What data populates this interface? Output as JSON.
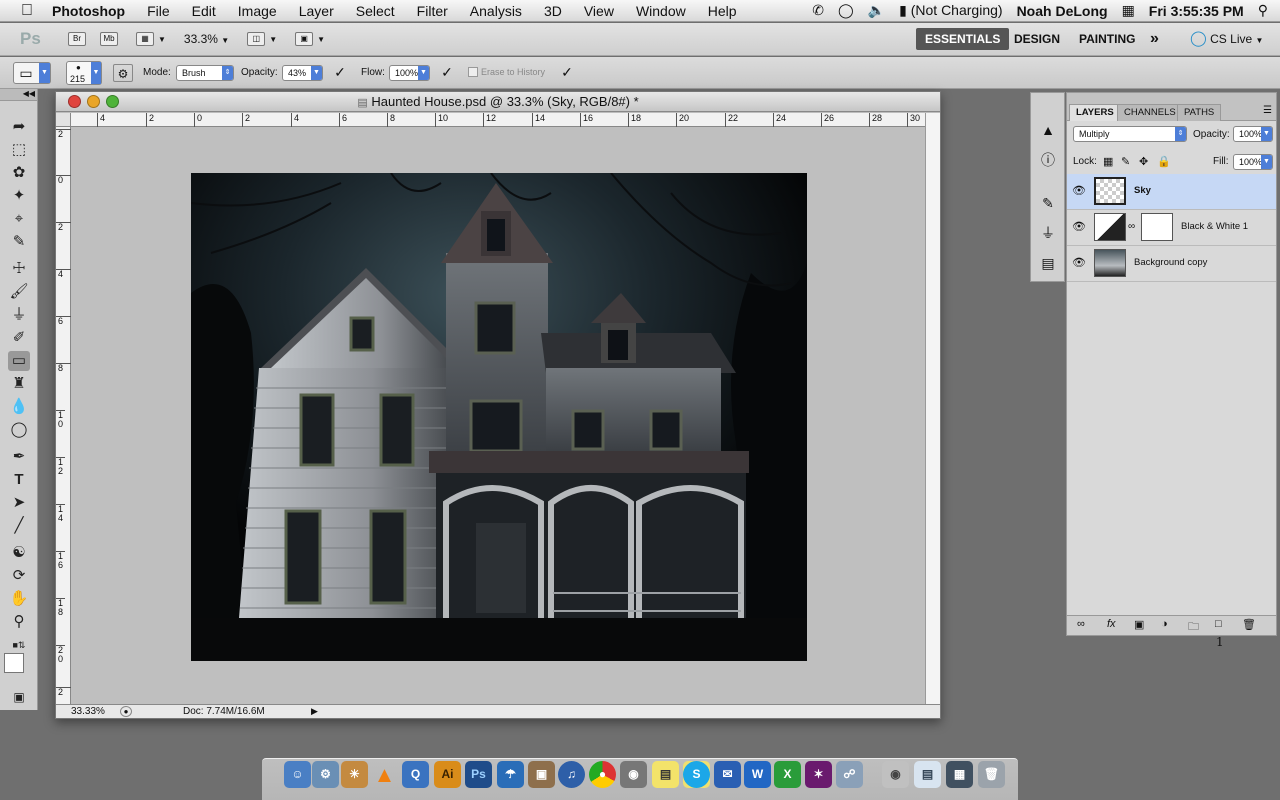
{
  "menubar": {
    "app_name": "Photoshop",
    "menus": [
      "File",
      "Edit",
      "Image",
      "Layer",
      "Select",
      "Filter",
      "Analysis",
      "3D",
      "View",
      "Window",
      "Help"
    ],
    "battery_status": "(Not Charging)",
    "user": "Noah DeLong",
    "clock": "Fri 3:55:35 PM"
  },
  "appbar": {
    "logo": "Ps",
    "bridge": "Br",
    "minibridge": "Mb",
    "zoom": "33.3%",
    "workspaces": [
      "ESSENTIALS",
      "DESIGN",
      "PAINTING"
    ],
    "active_workspace": "ESSENTIALS",
    "more": "»",
    "cs_live": "CS Live"
  },
  "options": {
    "brush_size": "215",
    "mode_label": "Mode:",
    "mode_value": "Brush",
    "opacity_label": "Opacity:",
    "opacity_value": "43%",
    "flow_label": "Flow:",
    "flow_value": "100%",
    "erase_to_history": "Erase to History"
  },
  "document": {
    "title": "Haunted House.psd @ 33.3% (Sky, RGB/8#) *",
    "ruler_h": [
      "4",
      "2",
      "0",
      "2",
      "4",
      "6",
      "8",
      "10",
      "12",
      "14",
      "16",
      "18",
      "20",
      "22",
      "24",
      "26",
      "28",
      "30"
    ],
    "ruler_v": [
      "2",
      "0",
      "2",
      "4",
      "6",
      "8",
      "1 0",
      "1 2",
      "1 4",
      "1 6",
      "1 8",
      "2 0",
      "2"
    ],
    "status_zoom": "33.33%",
    "status_doc": "Doc: 7.74M/16.6M"
  },
  "layers_panel": {
    "tabs": [
      "LAYERS",
      "CHANNELS",
      "PATHS"
    ],
    "blend_mode": "Multiply",
    "opacity_label": "Opacity:",
    "opacity_value": "100%",
    "lock_label": "Lock:",
    "fill_label": "Fill:",
    "fill_value": "100%",
    "layers": [
      {
        "name": "Sky",
        "selected": true
      },
      {
        "name": "Black & White 1",
        "selected": false
      },
      {
        "name": "Background copy",
        "selected": false
      }
    ],
    "footer_number": "1"
  },
  "colors": {
    "accent_blue": "#4d7ed8",
    "selected_layer": "#c6d8f5",
    "canvas_bg": "#bfbfbf",
    "desktop": "#6f6f6f"
  },
  "dock": {
    "icons": [
      "finder-icon",
      "system-prefs-icon",
      "iphoto-icon",
      "vlc-icon",
      "quicktime-icon",
      "illustrator-icon",
      "photoshop-icon",
      "umbrella-icon",
      "preview-icon",
      "itunes-icon",
      "chrome-icon",
      "camera-icon",
      "stickies-icon",
      "skype-icon",
      "mail-icon",
      "word-icon",
      "excel-icon",
      "fireworks-icon",
      "safari-icon",
      "disk-icon",
      "notes-icon",
      "activity-icon",
      "trash-icon"
    ]
  }
}
